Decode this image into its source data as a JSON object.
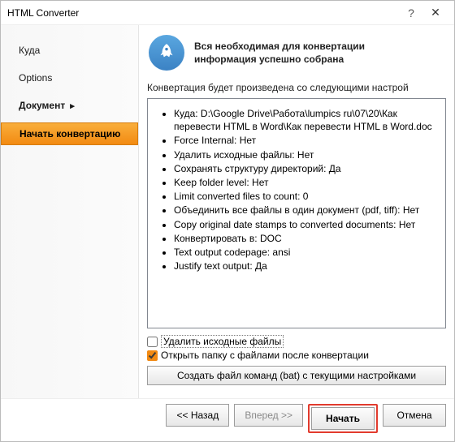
{
  "window": {
    "title": "HTML Converter"
  },
  "sidebar": {
    "items": [
      {
        "label": "Куда"
      },
      {
        "label": "Options"
      },
      {
        "label": "Документ"
      },
      {
        "label": "Начать конвертацию"
      }
    ]
  },
  "header": {
    "line1": "Вся необходимая для конвертации",
    "line2": "информация успешно собрана"
  },
  "subheading": "Конвертация будет произведена со следующими настрой",
  "settings": [
    "Куда: D:\\Google Drive\\Работа\\lumpics ru\\07\\20\\Как перевести HTML в Word\\Как перевести HTML в Word.doc",
    "Force Internal: Нет",
    "Удалить исходные файлы: Нет",
    "Сохранять структуру директорий: Да",
    "Keep folder level: Нет",
    "Limit converted files to count: 0",
    "Объединить все файлы в один документ (pdf, tiff): Нет",
    "Copy original date stamps to converted documents: Нет",
    "Конвертировать в: DOC",
    "Text output codepage: ansi",
    "Justify text output: Да"
  ],
  "checks": {
    "delete": {
      "label": "Удалить исходные файлы",
      "checked": false
    },
    "openFolder": {
      "label": "Открыть папку с файлами после конвертации",
      "checked": true
    }
  },
  "cmdButton": "Создать файл команд (bat) с текущими настройками",
  "buttons": {
    "back": "<< Назад",
    "next": "Вперед >>",
    "start": "Начать",
    "cancel": "Отмена"
  }
}
